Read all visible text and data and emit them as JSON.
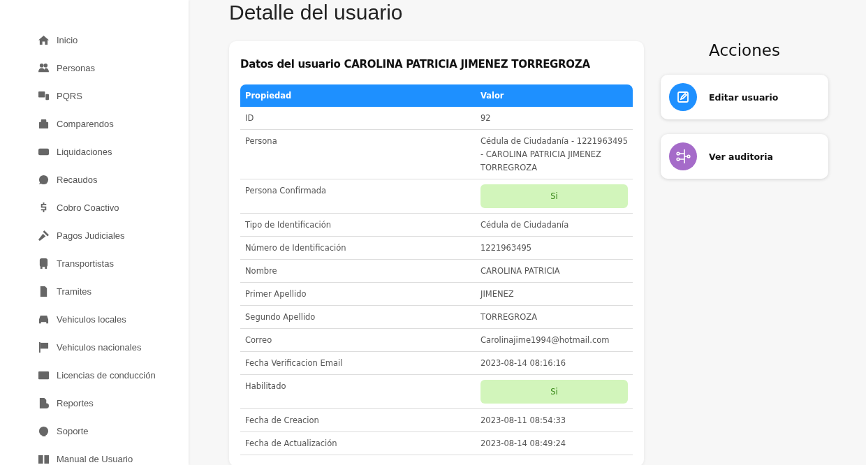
{
  "sidebar": {
    "items": [
      {
        "label": "Inicio"
      },
      {
        "label": "Personas"
      },
      {
        "label": "PQRS"
      },
      {
        "label": "Comparendos"
      },
      {
        "label": "Liquidaciones"
      },
      {
        "label": "Recaudos"
      },
      {
        "label": "Cobro Coactivo"
      },
      {
        "label": "Pagos Judiciales"
      },
      {
        "label": "Transportistas"
      },
      {
        "label": "Tramites"
      },
      {
        "label": "Vehiculos locales"
      },
      {
        "label": "Vehiculos nacionales"
      },
      {
        "label": "Licencias de conducción"
      },
      {
        "label": "Reportes"
      },
      {
        "label": "Soporte"
      },
      {
        "label": "Manual de Usuario"
      }
    ]
  },
  "page_title": "Detalle del usuario",
  "details": {
    "title": "Datos del usuario CAROLINA PATRICIA JIMENEZ TORREGROZA",
    "columns": [
      "Propiedad",
      "Valor"
    ],
    "rows": [
      {
        "property": "ID",
        "value": "92",
        "kind": "text"
      },
      {
        "property": "Persona",
        "value": "Cédula de Ciudadanía - 1221963495 - CAROLINA PATRICIA JIMENEZ TORREGROZA",
        "kind": "text"
      },
      {
        "property": "Persona Confirmada",
        "value": "Si",
        "kind": "badge"
      },
      {
        "property": "Tipo de Identificación",
        "value": "Cédula de Ciudadanía",
        "kind": "text"
      },
      {
        "property": "Número de Identificación",
        "value": "1221963495",
        "kind": "text"
      },
      {
        "property": "Nombre",
        "value": "CAROLINA PATRICIA",
        "kind": "text"
      },
      {
        "property": "Primer Apellido",
        "value": "JIMENEZ",
        "kind": "text"
      },
      {
        "property": "Segundo Apellido",
        "value": "TORREGROZA",
        "kind": "text"
      },
      {
        "property": "Correo",
        "value": "Carolinajime1994@hotmail.com",
        "kind": "text"
      },
      {
        "property": "Fecha Verificacion Email",
        "value": "2023-08-14 08:16:16",
        "kind": "text"
      },
      {
        "property": "Habilitado",
        "value": "Si",
        "kind": "badge"
      },
      {
        "property": "Fecha de Creacion",
        "value": "2023-08-11 08:54:33",
        "kind": "text"
      },
      {
        "property": "Fecha de Actualización",
        "value": "2023-08-14 08:49:24",
        "kind": "text"
      }
    ]
  },
  "actions": {
    "title": "Acciones",
    "items": [
      {
        "label": "Editar usuario",
        "color": "#1e90ff"
      },
      {
        "label": "Ver auditoria",
        "color": "#a56bc9"
      }
    ]
  }
}
